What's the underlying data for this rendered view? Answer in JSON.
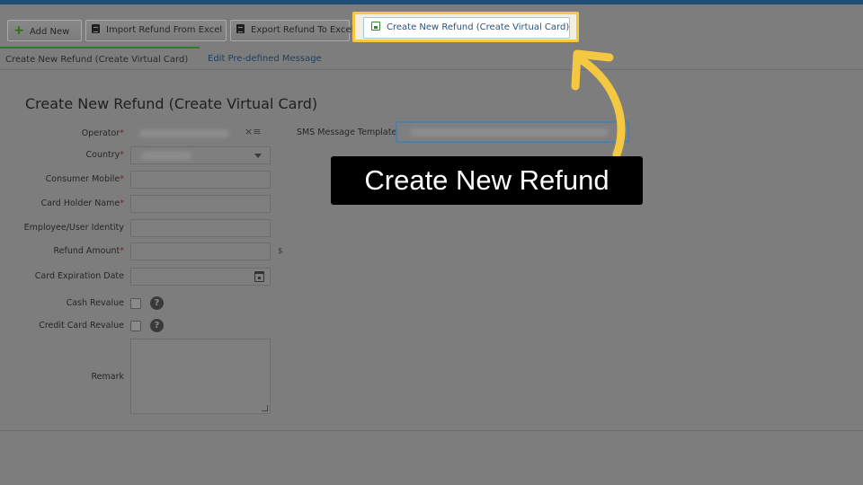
{
  "toolbar": {
    "add_new": "Add New",
    "import": "Import Refund From Excel",
    "export": "Export Refund To Excel",
    "create": "Create New Refund (Create Virtual Card)"
  },
  "tabs": [
    {
      "label": "Create New Refund (Create Virtual Card)",
      "active": true
    },
    {
      "label": "Edit Pre-defined Message",
      "active": false
    }
  ],
  "form": {
    "title": "Create New Refund (Create Virtual Card)",
    "fields": {
      "operator": {
        "label": "Operator",
        "required": true
      },
      "country": {
        "label": "Country",
        "required": true
      },
      "consumer_mobile": {
        "label": "Consumer Mobile",
        "required": true
      },
      "card_holder_name": {
        "label": "Card Holder Name",
        "required": true
      },
      "employee_identity": {
        "label": "Employee/User Identity",
        "required": false
      },
      "refund_amount": {
        "label": "Refund Amount",
        "required": true,
        "unit": "$"
      },
      "card_expiration_date": {
        "label": "Card Expiration Date",
        "required": false
      },
      "cash_revalue": {
        "label": "Cash Revalue",
        "checked": false
      },
      "credit_card_revalue": {
        "label": "Credit Card Revalue",
        "checked": false
      },
      "remark": {
        "label": "Remark"
      },
      "sms_template": {
        "label": "SMS Message Template"
      }
    },
    "required_mark": "*",
    "help_glyph": "?",
    "clear_glyph": "×≡"
  },
  "callout": {
    "text": "Create New Refund"
  },
  "colors": {
    "highlight": "#f5c842",
    "callout_bg": "#000000",
    "required": "#8c1a1a",
    "active_tab": "#2f7a2f"
  }
}
